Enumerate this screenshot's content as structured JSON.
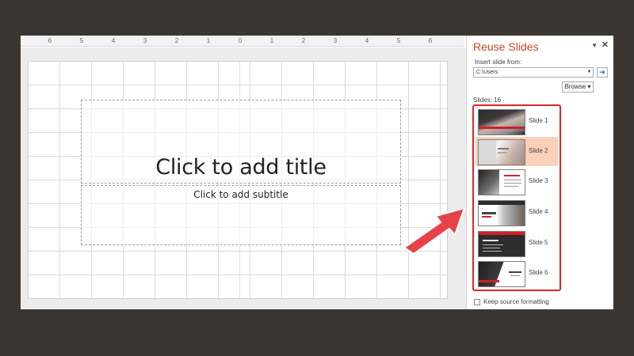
{
  "ruler": {
    "ticks": [
      "6",
      "5",
      "4",
      "3",
      "2",
      "1",
      "0",
      "1",
      "2",
      "3",
      "4",
      "5",
      "6"
    ]
  },
  "slide": {
    "title_placeholder": "Click to add title",
    "subtitle_placeholder": "Click to add subtitle"
  },
  "pane": {
    "title": "Reuse Slides",
    "menu_glyph": "▼",
    "close_glyph": "✕",
    "insert_label": "Insert slide from:",
    "path_value": "C:\\Users",
    "dropdown_glyph": "▼",
    "go_glyph": "➜",
    "browse_label": "Browse ▾",
    "slides_count": "Slides: 16",
    "keep_source_label": "Keep source formatting",
    "slides": [
      {
        "label": "Slide 1",
        "selected": false
      },
      {
        "label": "Slide 2",
        "selected": true
      },
      {
        "label": "Slide 3",
        "selected": false
      },
      {
        "label": "Slide 4",
        "selected": false
      },
      {
        "label": "Slide 5",
        "selected": false
      },
      {
        "label": "Slide 6",
        "selected": false
      }
    ]
  },
  "colors": {
    "accent": "#d24726",
    "highlight_border": "#e0242b",
    "selected_item": "#fbd0b9",
    "arrow": "#e8414a"
  }
}
